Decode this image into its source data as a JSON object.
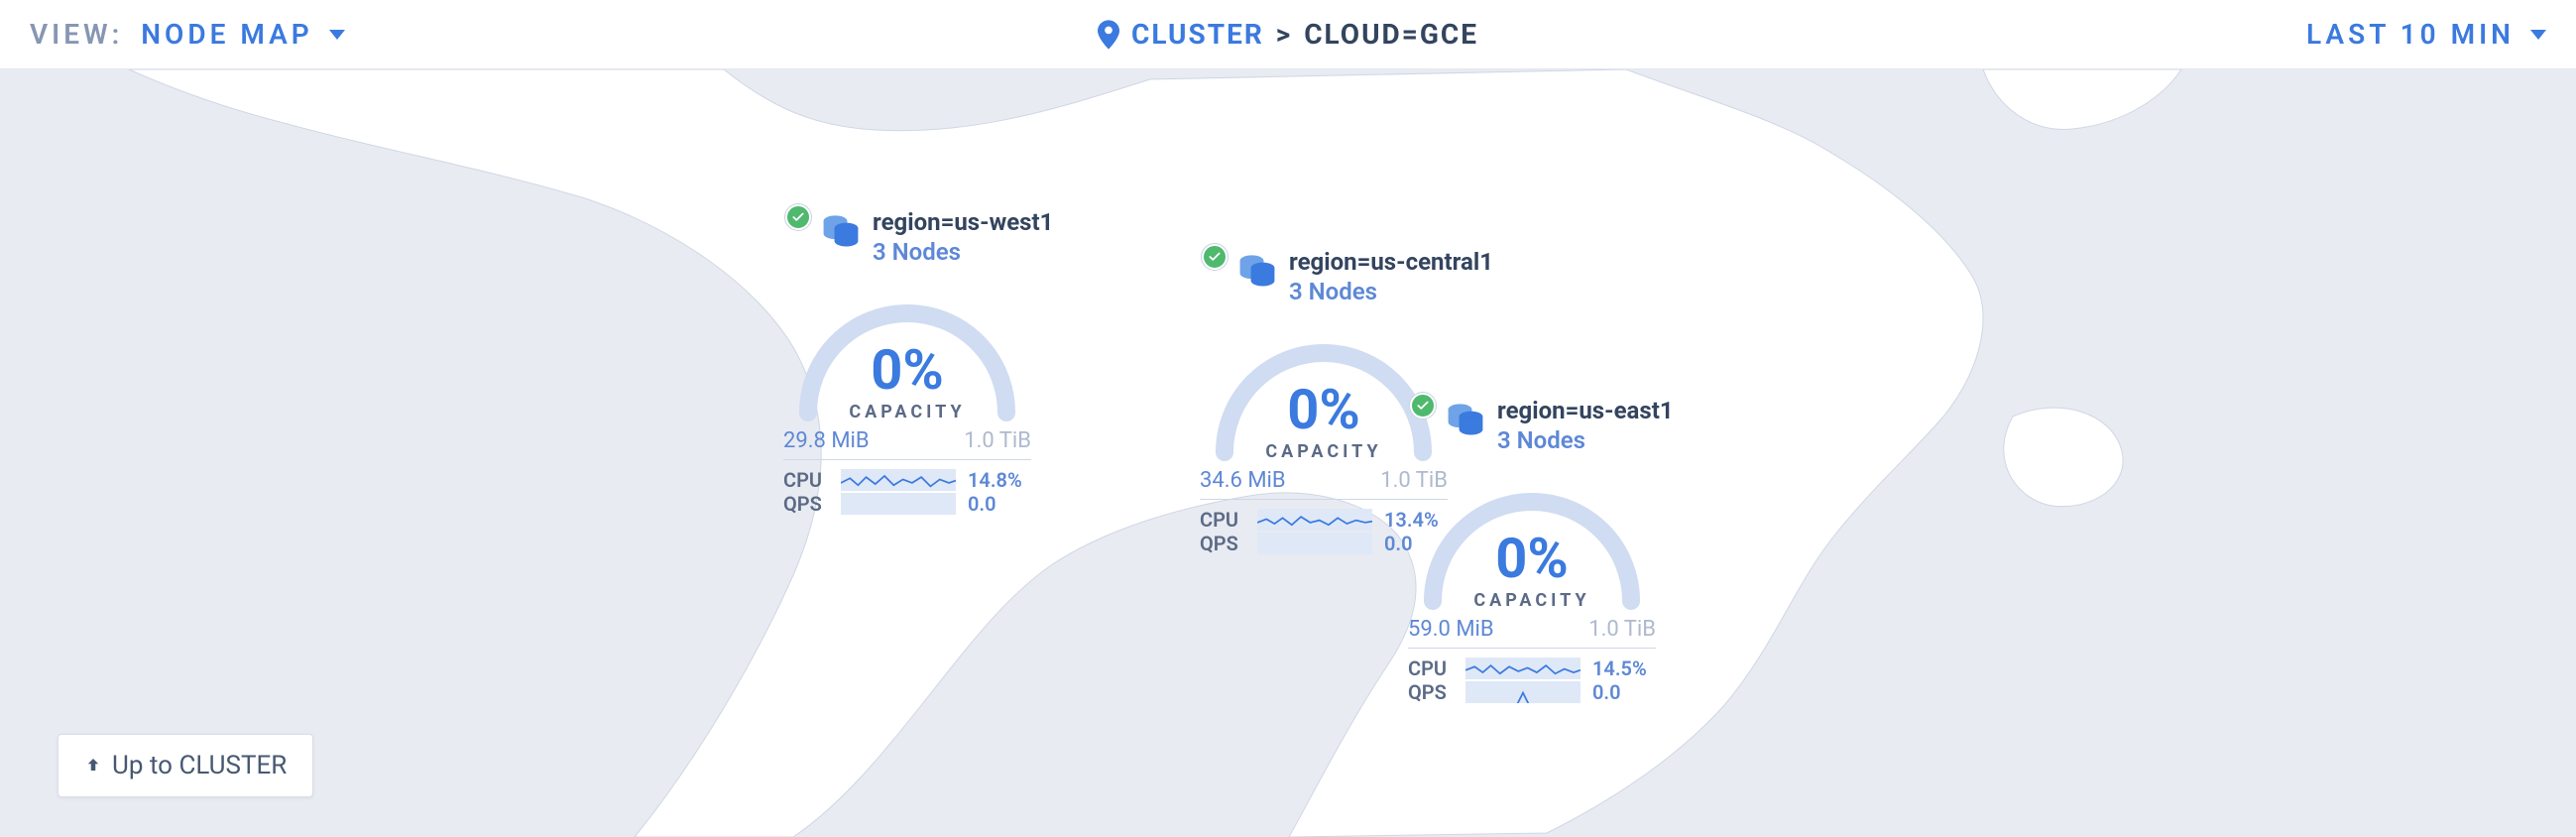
{
  "topbar": {
    "view_label": "VIEW:",
    "view_value": "NODE MAP",
    "cluster_label": "CLUSTER",
    "sep": ">",
    "crumb_current": "CLOUD=GCE",
    "time_label": "LAST 10 MIN"
  },
  "upbutton": {
    "label": "Up to CLUSTER"
  },
  "gauge": {
    "capacity_label": "CAPACITY",
    "cpu_label": "CPU",
    "qps_label": "QPS"
  },
  "nodes": [
    {
      "region": "region=us-west1",
      "count_label": "3 Nodes",
      "pct": "0%",
      "used": "29.8 MiB",
      "total": "1.0 TiB",
      "cpu": "14.8%",
      "qps": "0.0"
    },
    {
      "region": "region=us-central1",
      "count_label": "3 Nodes",
      "pct": "0%",
      "used": "34.6 MiB",
      "total": "1.0 TiB",
      "cpu": "13.4%",
      "qps": "0.0"
    },
    {
      "region": "region=us-east1",
      "count_label": "3 Nodes",
      "pct": "0%",
      "used": "59.0 MiB",
      "total": "1.0 TiB",
      "cpu": "14.5%",
      "qps": "0.0"
    }
  ]
}
